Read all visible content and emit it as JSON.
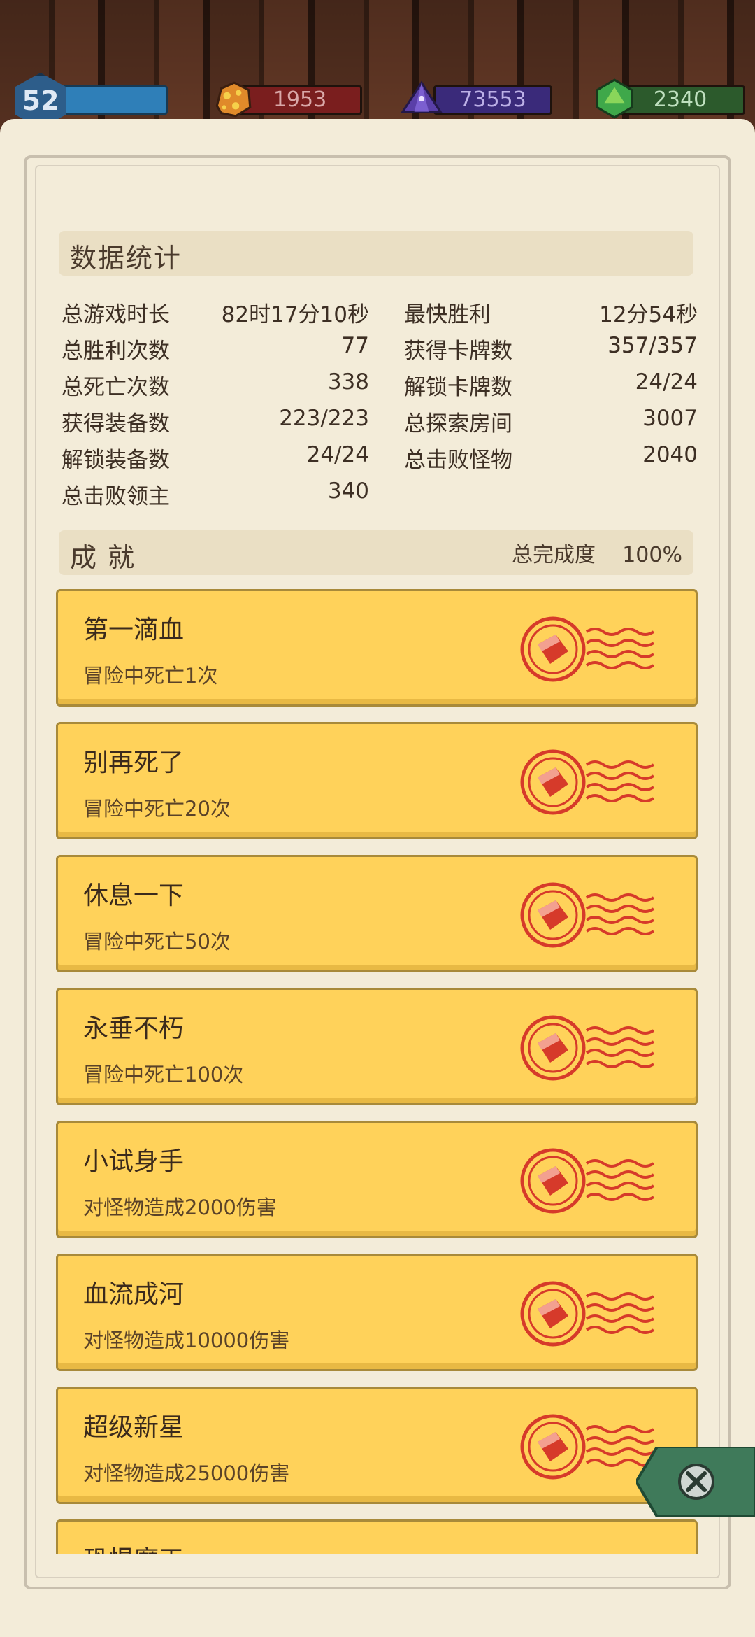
{
  "resources": {
    "level": "52",
    "gold": "1953",
    "crystal": "73553",
    "gem": "2340"
  },
  "stats_section": {
    "title": "数据统计",
    "left": [
      {
        "label": "总游戏时长",
        "value": "82时17分10秒"
      },
      {
        "label": "总胜利次数",
        "value": "77"
      },
      {
        "label": "总死亡次数",
        "value": "338"
      },
      {
        "label": "获得装备数",
        "value": "223/223"
      },
      {
        "label": "解锁装备数",
        "value": "24/24"
      },
      {
        "label": "总击败领主",
        "value": "340"
      }
    ],
    "right": [
      {
        "label": "最快胜利",
        "value": "12分54秒"
      },
      {
        "label": "获得卡牌数",
        "value": "357/357"
      },
      {
        "label": "解锁卡牌数",
        "value": "24/24"
      },
      {
        "label": "总探索房间",
        "value": "3007"
      },
      {
        "label": "总击败怪物",
        "value": "2040"
      }
    ]
  },
  "achievements_section": {
    "title": "成 就",
    "completion_label": "总完成度",
    "completion_value": "100%",
    "items": [
      {
        "name": "第一滴血",
        "desc": "冒险中死亡1次"
      },
      {
        "name": "别再死了",
        "desc": "冒险中死亡20次"
      },
      {
        "name": "休息一下",
        "desc": "冒险中死亡50次"
      },
      {
        "name": "永垂不朽",
        "desc": "冒险中死亡100次"
      },
      {
        "name": "小试身手",
        "desc": "对怪物造成2000伤害"
      },
      {
        "name": "血流成河",
        "desc": "对怪物造成10000伤害"
      },
      {
        "name": "超级新星",
        "desc": "对怪物造成25000伤害"
      },
      {
        "name": "恐惧魔王",
        "desc": ""
      }
    ]
  },
  "colors": {
    "card": "#ffd25a",
    "stamp": "#d63a2a",
    "paper": "#f3ecd9",
    "close_button": "#3f7a5a"
  },
  "icons": {
    "level": "hexagon-level-badge",
    "gold": "gold-ore-icon",
    "crystal": "purple-crystal-icon",
    "gem": "green-gem-icon",
    "stamp": "postmark-stamp-icon",
    "close": "close-icon"
  }
}
